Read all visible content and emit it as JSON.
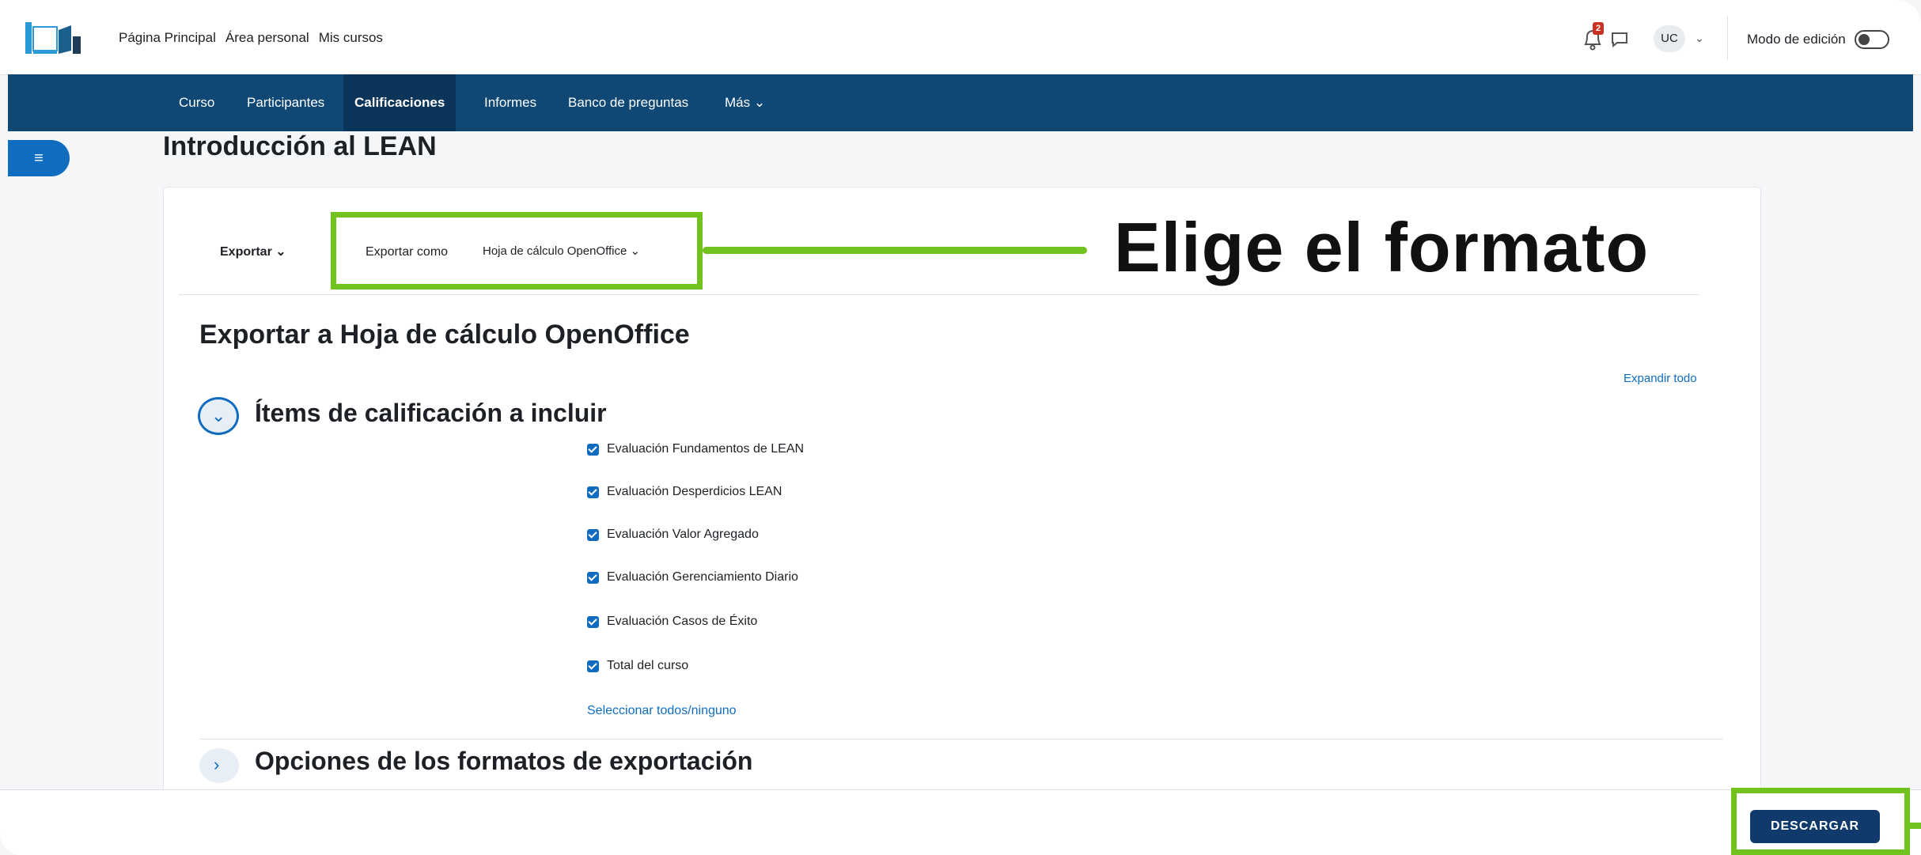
{
  "topnav": {
    "links": [
      "Página Principal",
      "Área personal",
      "Mis cursos"
    ],
    "notification_count": "2",
    "user_initials": "UC",
    "edit_mode_label": "Modo de edición"
  },
  "secnav": {
    "items": [
      "Curso",
      "Participantes",
      "Calificaciones",
      "Informes",
      "Banco de preguntas",
      "Más"
    ],
    "active": "Calificaciones"
  },
  "page": {
    "title": "Introducción al LEAN",
    "export_menu": "Exportar",
    "export_as_label": "Exportar como",
    "export_format": "Hoja de cálculo OpenOffice",
    "export_heading": "Exportar a Hoja de cálculo OpenOffice",
    "expand_all": "Expandir todo",
    "section_items_title": "Ítems de calificación a incluir",
    "grade_items": [
      "Evaluación Fundamentos de LEAN",
      "Evaluación Desperdicios LEAN",
      "Evaluación Valor Agregado",
      "Evaluación Gerenciamiento Diario",
      "Evaluación Casos de Éxito",
      "Total del curso"
    ],
    "select_all": "Seleccionar todos/ninguno",
    "section_options_title": "Opciones de los formatos de exportación",
    "download_button": "DESCARGAR"
  },
  "annotation": {
    "callout_text": "Elige el formato",
    "highlight_color": "#72c21f"
  },
  "colors": {
    "navbar": "#0f4775",
    "primary": "#0f6cbf"
  }
}
